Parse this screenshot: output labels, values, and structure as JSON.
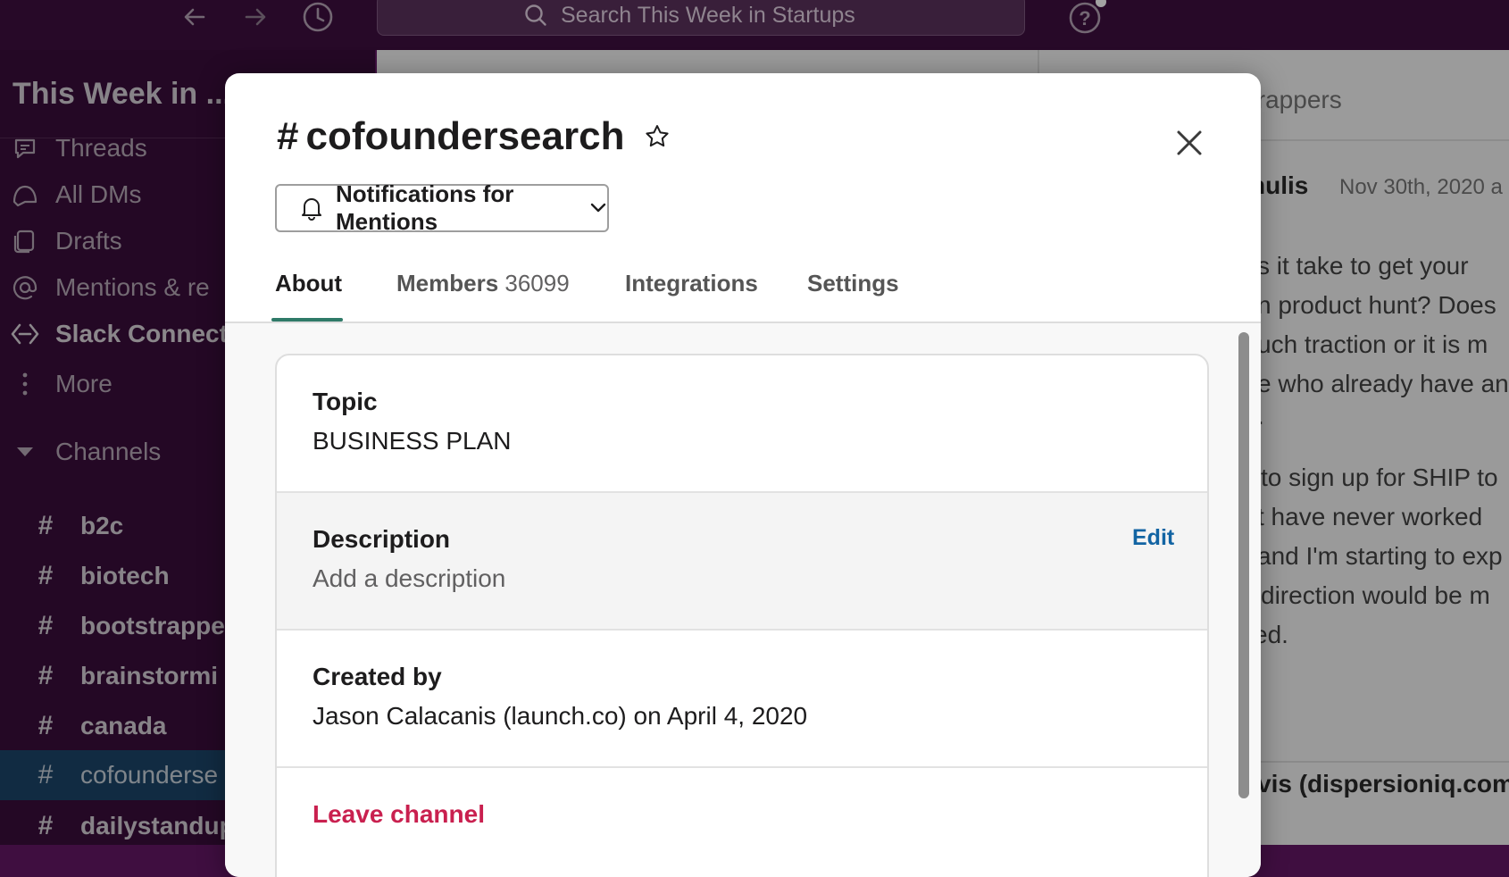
{
  "topbar": {
    "search_placeholder": "Search This Week in Startups"
  },
  "sidebar": {
    "workspace_name": "This Week in ...",
    "items": [
      {
        "label": "Threads",
        "icon": "threads-icon"
      },
      {
        "label": "All DMs",
        "icon": "dms-icon"
      },
      {
        "label": "Drafts",
        "icon": "drafts-icon"
      },
      {
        "label": "Mentions & re",
        "icon": "at-icon"
      },
      {
        "label": "Slack Connect",
        "icon": "slack-connect-icon"
      },
      {
        "label": "More",
        "icon": "more-icon"
      }
    ],
    "channels_header": "Channels",
    "channels": [
      {
        "hash": "#",
        "name": "b2c"
      },
      {
        "hash": "#",
        "name": "biotech"
      },
      {
        "hash": "#",
        "name": "bootstrappe"
      },
      {
        "hash": "#",
        "name": "brainstormi"
      },
      {
        "hash": "#",
        "name": "canada"
      },
      {
        "hash": "#",
        "name": "cofounderse"
      },
      {
        "hash": "#",
        "name": "dailystandup"
      }
    ]
  },
  "background": {
    "thread_header": "trappers",
    "author_partial": "nulis",
    "timestamp_partial": "Nov 30th, 2020 a",
    "message_lines": [
      "s it take to get your",
      "n product hunt? Does",
      "uch traction or it is m",
      "e who already have an",
      ".",
      "to sign up for SHIP to",
      "t have never worked",
      "and I'm starting to exp",
      "direction would be m",
      "ed."
    ],
    "next_author_partial": "vis (dispersioniq.com"
  },
  "modal": {
    "hash": "#",
    "channel_name": "cofoundersearch",
    "notifications_label": "Notifications for Mentions",
    "tabs": {
      "about": "About",
      "members": "Members",
      "members_count": "36099",
      "integrations": "Integrations",
      "settings": "Settings"
    },
    "topic": {
      "heading": "Topic",
      "value": "BUSINESS PLAN"
    },
    "description": {
      "heading": "Description",
      "value": "Add a description",
      "edit_label": "Edit"
    },
    "created_by": {
      "heading": "Created by",
      "value": "Jason Calacanis (launch.co) on April 4, 2020"
    },
    "leave_label": "Leave channel"
  },
  "colors": {
    "sidebar_bg": "#3f0e40",
    "active_channel": "#1e4a73",
    "accent_green": "#2f7a68",
    "link_blue": "#1264a3",
    "danger_red": "#c9204f"
  }
}
